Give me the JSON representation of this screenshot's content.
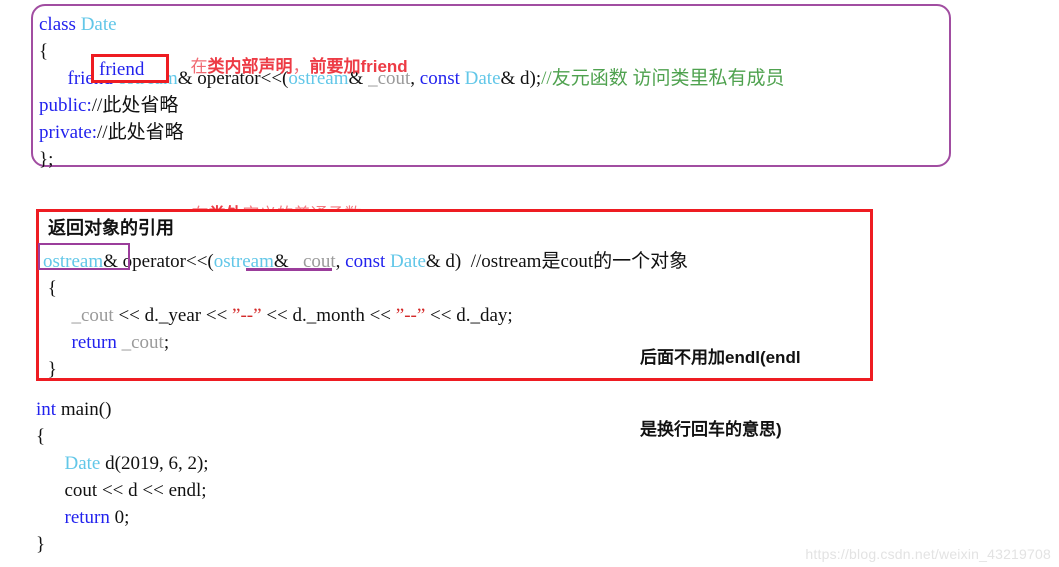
{
  "class_block": {
    "lines": [
      [
        {
          "text": "class ",
          "style": "kw"
        },
        {
          "text": "Date",
          "style": "type"
        }
      ],
      [
        {
          "text": "{",
          "style": "plain"
        }
      ],
      [
        {
          "text": "      friend ",
          "style": "kw"
        },
        {
          "text": "ostream",
          "style": "type"
        },
        {
          "text": "& operator<<(",
          "style": "plain"
        },
        {
          "text": "ostream",
          "style": "type"
        },
        {
          "text": "& ",
          "style": "plain"
        },
        {
          "text": "_cout",
          "style": "ident"
        },
        {
          "text": ", ",
          "style": "plain"
        },
        {
          "text": "const ",
          "style": "kw"
        },
        {
          "text": "Date",
          "style": "type"
        },
        {
          "text": "& d);",
          "style": "plain"
        },
        {
          "text": "//友元函数 访问类里私有成员",
          "style": "cmt-grn"
        }
      ],
      [
        {
          "text": "public:",
          "style": "kw"
        },
        {
          "text": "//此处省略",
          "style": "cmt-blk"
        }
      ],
      [
        {
          "text": "private:",
          "style": "kw"
        },
        {
          "text": "//此处省略",
          "style": "cmt-blk"
        }
      ],
      [
        {
          "text": "};",
          "style": "plain"
        }
      ]
    ]
  },
  "friend_highlight": {
    "label": "friend"
  },
  "annotation_inside_class": {
    "prefix": "在",
    "bold1": "类内部声明",
    "middle": "，",
    "bold2": "前要加friend"
  },
  "annotation_outside_class": {
    "prefix": "在",
    "bold": "类外",
    "suffix": "定义的普通函数"
  },
  "func_block": {
    "title": "返回对象的引用",
    "lines": [
      [
        {
          "text": "ostream",
          "style": "type"
        },
        {
          "text": "& operator<<(",
          "style": "plain"
        },
        {
          "text": "ostream",
          "style": "type"
        },
        {
          "text": "& ",
          "style": "plain"
        },
        {
          "text": "_cout",
          "style": "ident"
        },
        {
          "text": ", ",
          "style": "plain"
        },
        {
          "text": "const ",
          "style": "kw"
        },
        {
          "text": "Date",
          "style": "type"
        },
        {
          "text": "& d)  ",
          "style": "plain"
        },
        {
          "text": "//ostream是cout的一个对象",
          "style": "cmt-blk"
        }
      ],
      [
        {
          "text": " {",
          "style": "plain"
        }
      ],
      [
        {
          "text": "      ",
          "style": "plain"
        },
        {
          "text": "_cout",
          "style": "ident"
        },
        {
          "text": " << d.",
          "style": "plain"
        },
        {
          "text": "_year",
          "style": "plain"
        },
        {
          "text": " << ",
          "style": "plain"
        },
        {
          "text": "”--”",
          "style": "str"
        },
        {
          "text": " << d.",
          "style": "plain"
        },
        {
          "text": "_month",
          "style": "plain"
        },
        {
          "text": " << ",
          "style": "plain"
        },
        {
          "text": "”--”",
          "style": "str"
        },
        {
          "text": " << d.",
          "style": "plain"
        },
        {
          "text": "_day;",
          "style": "plain"
        }
      ],
      [
        {
          "text": "      ",
          "style": "plain"
        },
        {
          "text": "return ",
          "style": "kw"
        },
        {
          "text": "_cout",
          "style": "ident"
        },
        {
          "text": ";",
          "style": "plain"
        }
      ],
      [
        {
          "text": " }",
          "style": "plain"
        }
      ]
    ]
  },
  "annotation_endl": {
    "line1": "后面不用加endl(endl",
    "line2": "是换行回车的意思)"
  },
  "main_block": {
    "lines": [
      [
        {
          "text": "int ",
          "style": "kw"
        },
        {
          "text": "main()",
          "style": "plain"
        }
      ],
      [
        {
          "text": "{",
          "style": "plain"
        }
      ],
      [
        {
          "text": "      ",
          "style": "plain"
        },
        {
          "text": "Date",
          "style": "type"
        },
        {
          "text": " d(2019, 6, 2);",
          "style": "plain"
        }
      ],
      [
        {
          "text": "      cout << d << endl;",
          "style": "plain"
        }
      ],
      [
        {
          "text": "      ",
          "style": "plain"
        },
        {
          "text": "return ",
          "style": "kw"
        },
        {
          "text": "0;",
          "style": "plain"
        }
      ],
      [
        {
          "text": "}",
          "style": "plain"
        }
      ]
    ]
  },
  "watermark": {
    "text": "https://blog.csdn.net/weixin_43219708"
  },
  "colors": {
    "class_box_border": "#A14DA1",
    "func_box_border": "#EE1C22",
    "highlight_box_border": "#EE1C22",
    "ostream_box_border": "#9B3D9B",
    "keyword": "#2222EE",
    "type": "#62C7E8",
    "identifier": "#9a9a9a",
    "comment_green": "#4FA24F",
    "string": "#D42B2B",
    "annotation_red": "#ED3B45",
    "watermark": "#E3E3E3"
  }
}
